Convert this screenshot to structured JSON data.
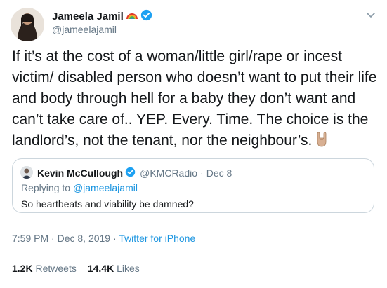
{
  "tweet": {
    "author_name": "Jameela Jamil",
    "author_handle": "@jameelajamil",
    "text": "If it’s at the cost of a woman/little girl/rape or incest victim/ disabled person who doesn’t want to put their life and body through hell for a baby they don’t want and can’t take care of.. YEP. Every. Time. The choice is the landlord’s, not the tenant, nor the neighbour’s.",
    "time": "7:59 PM",
    "separator": "·",
    "date": "Dec 8, 2019",
    "source": "Twitter for iPhone",
    "retweets_count": "1.2K",
    "retweets_label": "Retweets",
    "likes_count": "14.4K",
    "likes_label": "Likes",
    "icons": [
      "rainbow-icon",
      "verified-badge-icon",
      "chevron-down-icon",
      "sign-of-the-horns-emoji-icon"
    ]
  },
  "quoted": {
    "author_name": "Kevin McCullough",
    "author_handle": "@KMCRadio",
    "date": "Dec 8",
    "reply_prefix": "Replying to",
    "reply_to": "@jameelajamil",
    "text": "So heartbeats and viability be damned?"
  },
  "colors": {
    "text": "#14171a",
    "secondary": "#657786",
    "link": "#1b95e0",
    "verified": "#1da1f2",
    "border": "#ccd6dd"
  }
}
